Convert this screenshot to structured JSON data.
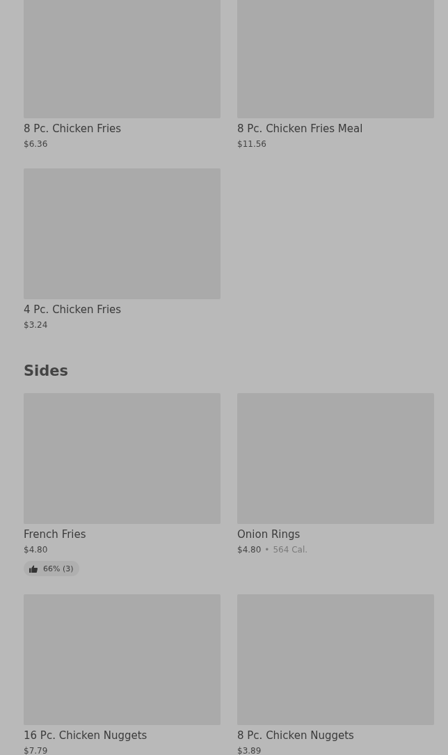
{
  "sections": [
    {
      "items": [
        {
          "name": "8 Pc. Chicken Fries",
          "price": "$6.36"
        },
        {
          "name": "8 Pc. Chicken Fries Meal",
          "price": "$11.56"
        },
        {
          "name": "4 Pc. Chicken Fries",
          "price": "$3.24"
        }
      ]
    },
    {
      "heading": "Sides",
      "items": [
        {
          "name": "French Fries",
          "price": "$4.80",
          "rating": "66% (3)"
        },
        {
          "name": "Onion Rings",
          "price": "$4.80",
          "separator": "•",
          "calories": "564 Cal."
        },
        {
          "name": "16 Pc. Chicken Nuggets",
          "price": "$7.79"
        },
        {
          "name": "8 Pc. Chicken Nuggets",
          "price": "$3.89"
        }
      ]
    }
  ]
}
